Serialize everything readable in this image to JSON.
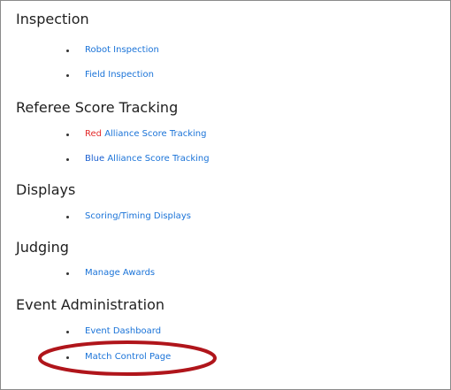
{
  "sections": [
    {
      "heading": "Inspection",
      "items": [
        {
          "label": "Robot Inspection"
        },
        {
          "label": "Field Inspection"
        }
      ]
    },
    {
      "heading": "Referee Score Tracking",
      "items": [
        {
          "prefix": "Red",
          "label": "Alliance Score Tracking"
        },
        {
          "prefix": "Blue",
          "label": "Alliance Score Tracking"
        }
      ]
    },
    {
      "heading": "Displays",
      "items": [
        {
          "label": "Scoring/Timing Displays"
        }
      ]
    },
    {
      "heading": "Judging",
      "items": [
        {
          "label": "Manage Awards"
        }
      ]
    },
    {
      "heading": "Event Administration",
      "items": [
        {
          "label": "Event Dashboard"
        },
        {
          "label": "Match Control Page"
        }
      ]
    }
  ],
  "colors": {
    "link": "#1a73d8",
    "red_alliance": "#e32b2b",
    "blue_alliance": "#1a5fd0",
    "highlight_circle": "#b0151b"
  }
}
